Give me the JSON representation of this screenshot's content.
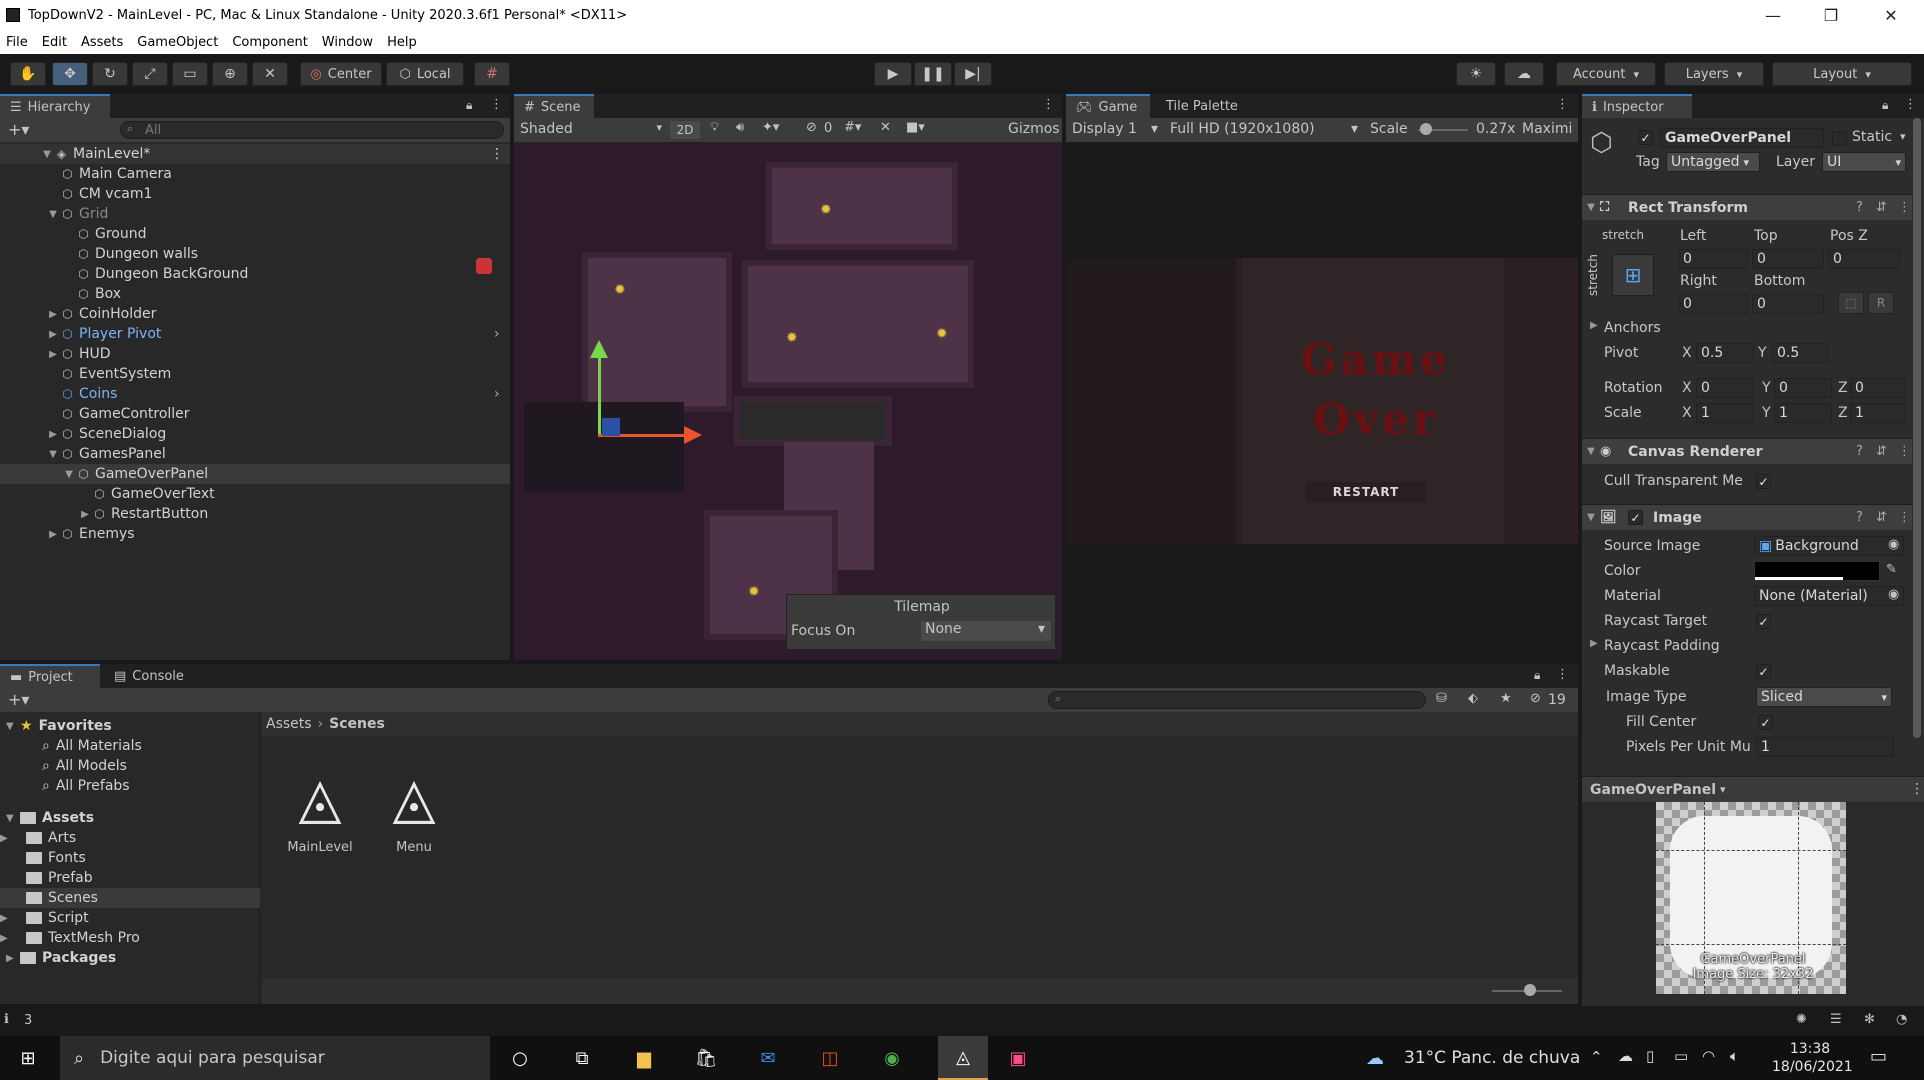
{
  "window": {
    "title": "TopDownV2 - MainLevel - PC, Mac & Linux Standalone - Unity 2020.3.6f1 Personal* <DX11>",
    "minimize": "—",
    "maximize": "❐",
    "close": "✕"
  },
  "menu": [
    "File",
    "Edit",
    "Assets",
    "GameObject",
    "Component",
    "Window",
    "Help"
  ],
  "toolbar": {
    "center_label": "Center",
    "local_label": "Local",
    "account_label": "Account",
    "layers_label": "Layers",
    "layout_label": "Layout"
  },
  "hierarchy": {
    "tab_label": "Hierarchy",
    "search_placeholder": "All",
    "scene_name": "MainLevel*",
    "items": [
      {
        "label": "Main Camera",
        "depth": 1,
        "arrow": "",
        "type": "normal"
      },
      {
        "label": "CM vcam1",
        "depth": 1,
        "arrow": "",
        "type": "normal"
      },
      {
        "label": "Grid",
        "depth": 1,
        "arrow": "▼",
        "type": "dim"
      },
      {
        "label": "Ground",
        "depth": 2,
        "arrow": "",
        "type": "normal"
      },
      {
        "label": "Dungeon walls",
        "depth": 2,
        "arrow": "",
        "type": "normal"
      },
      {
        "label": "Dungeon BackGround",
        "depth": 2,
        "arrow": "",
        "type": "normal"
      },
      {
        "label": "Box",
        "depth": 2,
        "arrow": "",
        "type": "normal"
      },
      {
        "label": "CoinHolder",
        "depth": 1,
        "arrow": "▶",
        "type": "normal"
      },
      {
        "label": "Player Pivot",
        "depth": 1,
        "arrow": "▶",
        "type": "prefab"
      },
      {
        "label": "HUD",
        "depth": 1,
        "arrow": "▶",
        "type": "normal"
      },
      {
        "label": "EventSystem",
        "depth": 1,
        "arrow": "",
        "type": "normal"
      },
      {
        "label": "Coins",
        "depth": 1,
        "arrow": "",
        "type": "prefab"
      },
      {
        "label": "GameController",
        "depth": 1,
        "arrow": "",
        "type": "normal"
      },
      {
        "label": "SceneDialog",
        "depth": 1,
        "arrow": "▶",
        "type": "normal"
      },
      {
        "label": "GamesPanel",
        "depth": 1,
        "arrow": "▼",
        "type": "normal"
      },
      {
        "label": "GameOverPanel",
        "depth": 2,
        "arrow": "▼",
        "type": "selected"
      },
      {
        "label": "GameOverText",
        "depth": 3,
        "arrow": "",
        "type": "normal"
      },
      {
        "label": "RestartButton",
        "depth": 3,
        "arrow": "▶",
        "type": "normal"
      },
      {
        "label": "Enemys",
        "depth": 1,
        "arrow": "▶",
        "type": "normal"
      }
    ]
  },
  "scene": {
    "tab_label": "Scene",
    "shading": "Shaded",
    "mode_2d": "2D",
    "hidden_count": "0",
    "gizmos": "Gizmos",
    "tilemap_title": "Tilemap",
    "focus_label": "Focus On",
    "focus_value": "None"
  },
  "game": {
    "tab_label": "Game",
    "palette_tab": "Tile Palette",
    "display": "Display 1",
    "resolution": "Full HD (1920x1080)",
    "scale_label": "Scale",
    "scale_value": "0.27x",
    "maximize": "Maximi",
    "game_over_line1": "Game",
    "game_over_line2": "Over",
    "restart": "RESTART"
  },
  "inspector": {
    "tab_label": "Inspector",
    "object_name": "GameOverPanel",
    "static_label": "Static",
    "tag_label": "Tag",
    "tag_value": "Untagged",
    "layer_label": "Layer",
    "layer_value": "UI",
    "rect": {
      "title": "Rect Transform",
      "stretch": "stretch",
      "left_label": "Left",
      "top_label": "Top",
      "posz_label": "Pos Z",
      "left": "0",
      "top": "0",
      "posz": "0",
      "right_label": "Right",
      "bottom_label": "Bottom",
      "right": "0",
      "bottom": "0",
      "anchors": "Anchors",
      "pivot_label": "Pivot",
      "pivot_x": "0.5",
      "pivot_y": "0.5",
      "rotation_label": "Rotation",
      "rot_x": "0",
      "rot_y": "0",
      "rot_z": "0",
      "scale_label": "Scale",
      "scale_x": "1",
      "scale_y": "1",
      "scale_z": "1",
      "x": "X",
      "y": "Y",
      "z": "Z",
      "r_btn": "R"
    },
    "canvas_renderer": {
      "title": "Canvas Renderer",
      "cull_label": "Cull Transparent Me"
    },
    "image": {
      "title": "Image",
      "source_label": "Source Image",
      "source_value": "Background",
      "color_label": "Color",
      "material_label": "Material",
      "material_value": "None (Material)",
      "raycast_label": "Raycast Target",
      "padding_label": "Raycast Padding",
      "maskable_label": "Maskable",
      "type_label": "Image Type",
      "type_value": "Sliced",
      "fill_label": "Fill Center",
      "ppu_label": "Pixels Per Unit Mu",
      "ppu_value": "1"
    },
    "preview": {
      "title": "GameOverPanel",
      "caption1": "GameOverPanel",
      "caption2": "Image Size: 32x32"
    }
  },
  "project": {
    "tab_project": "Project",
    "tab_console": "Console",
    "hidden_count": "19",
    "breadcrumb_root": "Assets",
    "breadcrumb_sep": "›",
    "breadcrumb_current": "Scenes",
    "tree": [
      {
        "label": "Favorites",
        "kind": "header",
        "depth": 0
      },
      {
        "label": "All Materials",
        "kind": "search",
        "depth": 1
      },
      {
        "label": "All Models",
        "kind": "search",
        "depth": 1
      },
      {
        "label": "All Prefabs",
        "kind": "search",
        "depth": 1
      },
      {
        "label": "Assets",
        "kind": "header-folder",
        "depth": 0
      },
      {
        "label": "Arts",
        "kind": "folder-arrow",
        "depth": 1
      },
      {
        "label": "Fonts",
        "kind": "folder",
        "depth": 1
      },
      {
        "label": "Prefab",
        "kind": "folder",
        "depth": 1
      },
      {
        "label": "Scenes",
        "kind": "folder-sel",
        "depth": 1
      },
      {
        "label": "Script",
        "kind": "folder-arrow",
        "depth": 1
      },
      {
        "label": "TextMesh Pro",
        "kind": "folder-arrow",
        "depth": 1
      },
      {
        "label": "Packages",
        "kind": "header-folder",
        "depth": 0
      }
    ],
    "assets": [
      "MainLevel",
      "Menu"
    ]
  },
  "status": {
    "count": "3"
  },
  "taskbar": {
    "search_placeholder": "Digite aqui para pesquisar",
    "weather": "31°C  Panc. de chuva",
    "time": "13:38",
    "date": "18/06/2021"
  },
  "colors": {
    "accent": "#3a79bb",
    "prefab": "#7db4f7",
    "panel": "#282828",
    "scene_bg": "#2d1a2b"
  }
}
